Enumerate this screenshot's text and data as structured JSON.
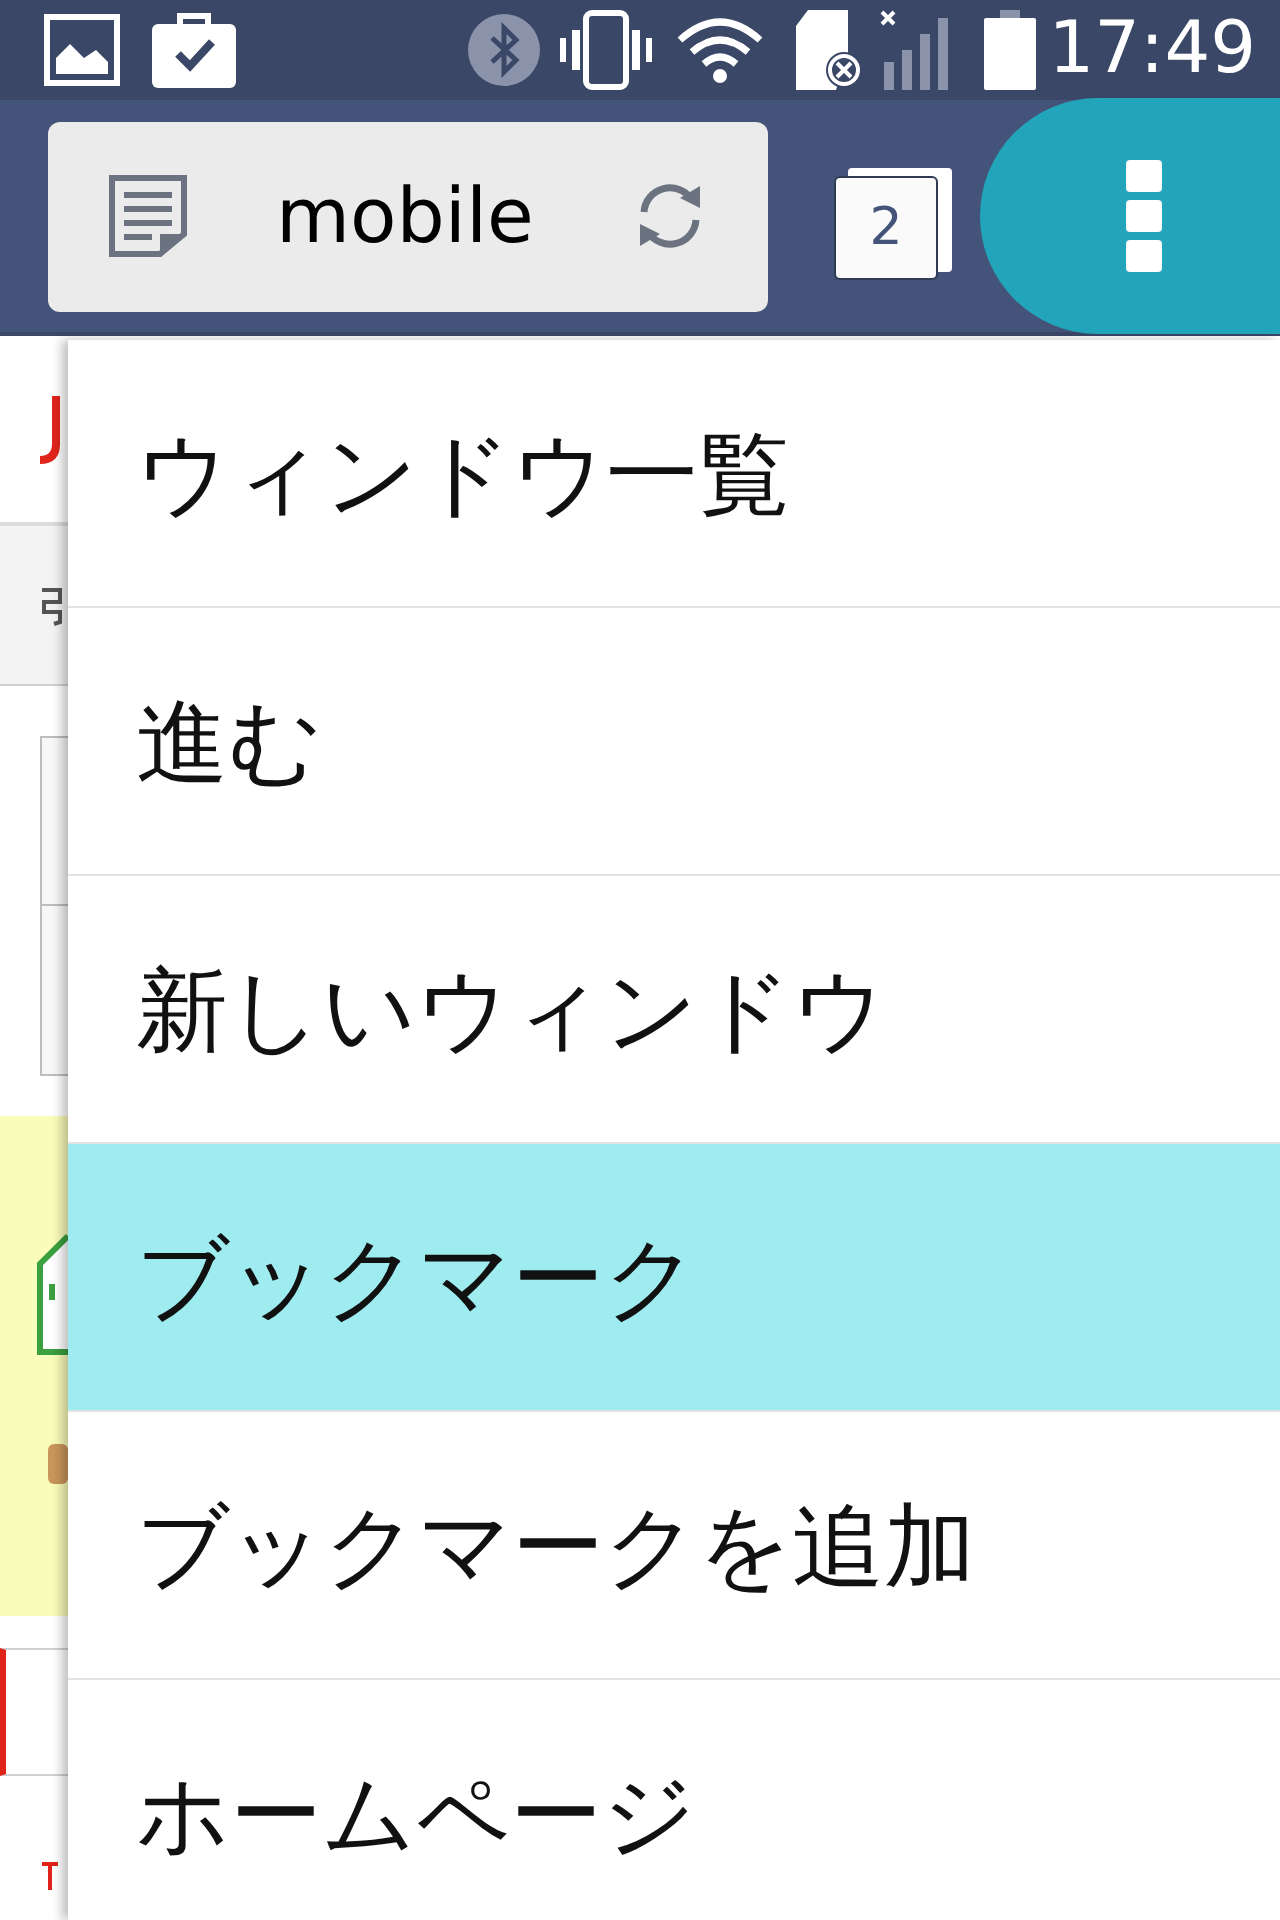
{
  "status_bar": {
    "time": "17:49"
  },
  "toolbar": {
    "address": "mobile",
    "tab_count": "2"
  },
  "menu": {
    "items": [
      {
        "label": "ウィンドウ一覧",
        "selected": false
      },
      {
        "label": "進む",
        "selected": false
      },
      {
        "label": "新しいウィンドウ",
        "selected": false
      },
      {
        "label": "ブックマーク",
        "selected": true
      },
      {
        "label": "ブックマークを追加",
        "selected": false
      },
      {
        "label": "ホームページ",
        "selected": false
      }
    ]
  }
}
